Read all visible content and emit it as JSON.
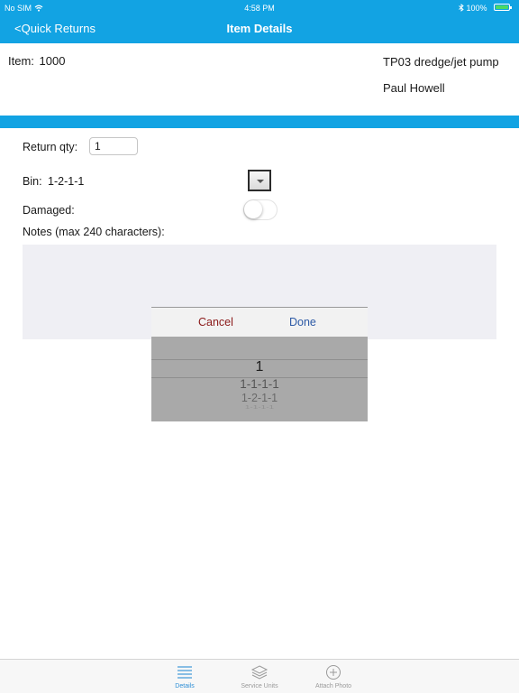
{
  "status": {
    "carrier": "No SIM",
    "time": "4:58 PM",
    "battery": "100%"
  },
  "nav": {
    "back_label": "<Quick Returns",
    "title": "Item Details"
  },
  "item": {
    "label": "Item:",
    "number": "1000",
    "description": "TP03 dredge/jet pump",
    "person": "Paul Howell"
  },
  "form": {
    "return_qty_label": "Return qty:",
    "return_qty_value": "1",
    "bin_label": "Bin:",
    "bin_value": "1-2-1-1",
    "damaged_label": "Damaged:",
    "damaged_on": false,
    "notes_label": "Notes (max 240 characters):",
    "notes_value": ""
  },
  "picker": {
    "cancel_label": "Cancel",
    "done_label": "Done",
    "selected": "1",
    "options": [
      "1-1-1-1",
      "1-2-1-1",
      "1-1-1-1"
    ]
  },
  "tabs": [
    {
      "label": "Details",
      "icon": "list-icon",
      "active": true
    },
    {
      "label": "Service Units",
      "icon": "layers-icon",
      "active": false
    },
    {
      "label": "Attach Photo",
      "icon": "plus-circle-icon",
      "active": false
    }
  ],
  "colors": {
    "accent": "#12a3e3",
    "tab_active": "#2f8fd6",
    "tab_inactive": "#9a9a9a",
    "cancel": "#8b1a1a",
    "done": "#2d5aa6"
  }
}
